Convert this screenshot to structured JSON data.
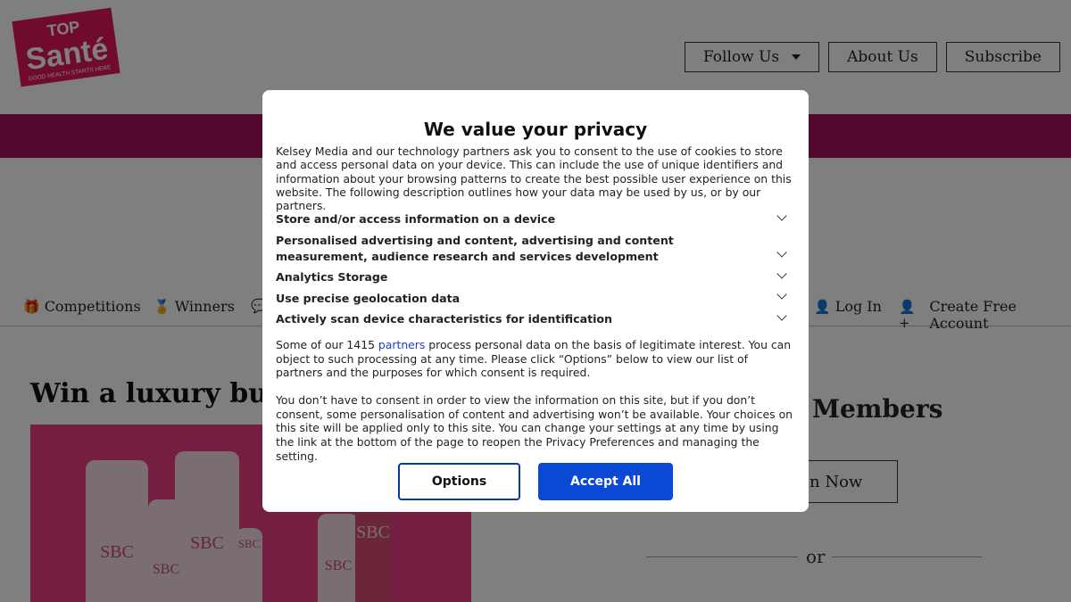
{
  "header": {
    "logo": {
      "top": "TOP",
      "main": "Santé",
      "tagline": "GOOD HEALTH STARTS HERE"
    },
    "buttons": {
      "follow": "Follow Us",
      "about": "About Us",
      "subscribe": "Subscribe"
    }
  },
  "nav": {
    "competitions": "Competitions",
    "winners": "Winners",
    "login": "Log In",
    "create_account": "Create Free Account"
  },
  "article": {
    "title_visible": "Win a luxury bundl",
    "product_brand": "SBC"
  },
  "sidebar": {
    "members_heading": "Members",
    "join_button_partial": "n Now",
    "or_text": "or"
  },
  "consent": {
    "title": "We value your privacy",
    "intro": "Kelsey Media and our technology partners ask you to consent to the use of cookies to store and access personal data on your device. This can include the use of unique identifiers and information about your browsing patterns to create the best possible user experience on this website. The following description outlines how your data may be used by us, or by our partners.",
    "purposes": [
      "Store and/or access information on a device",
      "Personalised advertising and content, advertising and content measurement, audience research and services development",
      "Analytics Storage",
      "Use precise geolocation data",
      "Actively scan device characteristics for identification"
    ],
    "legit_prefix": "Some of our 1415 ",
    "partners_link": "partners",
    "legit_suffix": " process personal data on the basis of legitimate interest. You can object to such processing at any time. Please click “Options” below to view our list of partners and the purposes for which consent is required.",
    "no_consent": "You don’t have to consent in order to view the information on this site, but if you don’t consent, some personalisation of content and advertising won’t be available. Your choices on this site will be applied only to this site. You can change your settings at any time by using the link at the bottom of the page to reopen the Privacy Preferences and managing the setting.",
    "options_label": "Options",
    "accept_label": "Accept All"
  },
  "colors": {
    "brand_pink": "#a0125a",
    "logo_pink": "#e1165e",
    "accept_blue": "#0b48d4",
    "overlay": "rgba(0,0,0,0.5)"
  }
}
